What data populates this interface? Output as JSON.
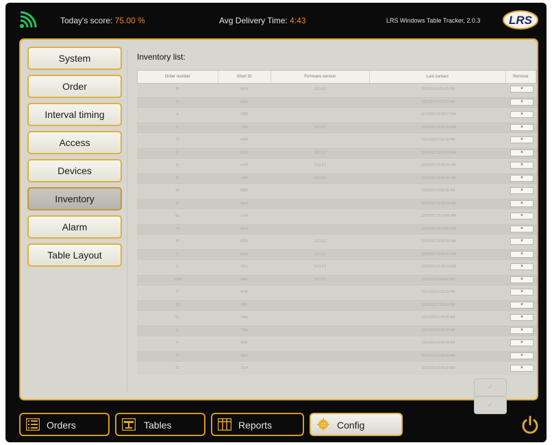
{
  "header": {
    "score_label": "Today's score:",
    "score_value": "75.00 %",
    "avg_label": "Avg Delivery Time:",
    "avg_value": "4:43",
    "tracker_text": "LRS Windows Table Tracker, 2.0.3",
    "logo_text": "LRS",
    "accent_color": "#f08a1c"
  },
  "sidebar": {
    "items": [
      {
        "label": "System"
      },
      {
        "label": "Order"
      },
      {
        "label": "Interval timing"
      },
      {
        "label": "Access"
      },
      {
        "label": "Devices"
      },
      {
        "label": "Inventory",
        "active": true
      },
      {
        "label": "Alarm"
      },
      {
        "label": "Table Layout"
      }
    ]
  },
  "inventory": {
    "title": "Inventory list:",
    "columns": [
      "Order number",
      "Short ID",
      "Firmware version",
      "Last contact",
      "Remove"
    ],
    "rows": [
      [
        "35",
        "9b34",
        "13.3.3.2",
        "11/1/2013 6:53:25 PM"
      ],
      [
        "19",
        "9ede",
        "",
        "11/1/2013 6:53:13 AM"
      ],
      [
        "4",
        "1380",
        "",
        "11/1/2013 10:59:17 AM"
      ],
      [
        "31",
        "7903",
        "13.3.3.2",
        "11/6/2013 10:00:19 AM"
      ],
      [
        "33",
        "e905",
        "",
        "11/1/2013 2:59:16 PM"
      ],
      [
        "6",
        "6551",
        "13.3.3.2",
        "11/6/2013 10:00:13 AM"
      ],
      [
        "37",
        "ea76",
        "13.3.3.2",
        "11/6/2013 10:00:21 AM"
      ],
      [
        "26",
        "c850",
        "13.3.3.2",
        "11/6/2013 10:00:46 AM"
      ],
      [
        "39",
        "9683",
        "",
        "11/6/2013 9:56:32 AM"
      ],
      [
        "11",
        "3ec5",
        "",
        "11/6/2013 10:00:15 AM"
      ],
      [
        "80",
        "c104",
        "",
        "11/6/2013 10:14:55 AM"
      ],
      [
        "78",
        "64c4",
        "",
        "11/6/2013 10:14:57 AM"
      ],
      [
        "39",
        "837b",
        "13.3.3.2",
        "11/6/2013 10:00:36 AM"
      ],
      [
        "1",
        "6ee3",
        "13.3.3.4",
        "11/6/2013 10:00:47 AM"
      ],
      [
        "2",
        "7811",
        "13.3.3.2",
        "11/6/2013 10:00:13 AM"
      ],
      [
        "9999",
        "6f6b",
        "13.3.3.2",
        "11/1/2013 4:04:41 PM"
      ],
      [
        "5",
        "4c46",
        "",
        "11/1/2013 3:33:53 PM"
      ],
      [
        "18",
        "4f50",
        "",
        "11/1/2013 1:25:14 PM"
      ],
      [
        "81",
        "786e",
        "",
        "11/1/2013 1:43:05 AM"
      ],
      [
        "6",
        "714a",
        "",
        "11/1/2013 8:43:33 AM"
      ],
      [
        "9",
        "6f33",
        "",
        "11/1/2013 8:43:33 AM"
      ],
      [
        "13",
        "6fb3",
        "",
        "11/1/2013 8:43:33 AM"
      ],
      [
        "15",
        "7914",
        "",
        "11/1/2013 8:43:33 AM"
      ]
    ],
    "remove_glyph": "×",
    "ok_glyph": "✓"
  },
  "bottom": {
    "orders_label": "Orders",
    "tables_label": "Tables",
    "reports_label": "Reports",
    "config_label": "Config"
  }
}
